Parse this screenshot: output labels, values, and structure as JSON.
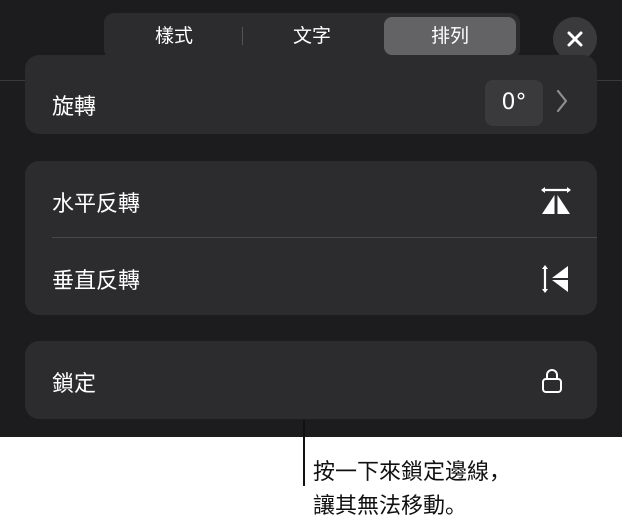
{
  "tabs": [
    {
      "label": "樣式"
    },
    {
      "label": "文字"
    },
    {
      "label": "排列",
      "selected": true
    }
  ],
  "close_icon": "close-icon",
  "rotate": {
    "label": "旋轉",
    "value": "0°",
    "icon": "chevron-right-icon"
  },
  "flip": {
    "horizontal_label": "水平反轉",
    "horizontal_icon": "flip-horizontal-icon",
    "vertical_label": "垂直反轉",
    "vertical_icon": "flip-vertical-icon"
  },
  "lock": {
    "label": "鎖定",
    "icon": "lock-icon"
  },
  "callout": {
    "text": "按一下來鎖定邊線，\n讓其無法移動。"
  },
  "colors": {
    "panel_bg": "#1c1c1e",
    "group_bg": "#2c2c2e",
    "selected_tab": "#636366",
    "text": "#ffffff"
  }
}
